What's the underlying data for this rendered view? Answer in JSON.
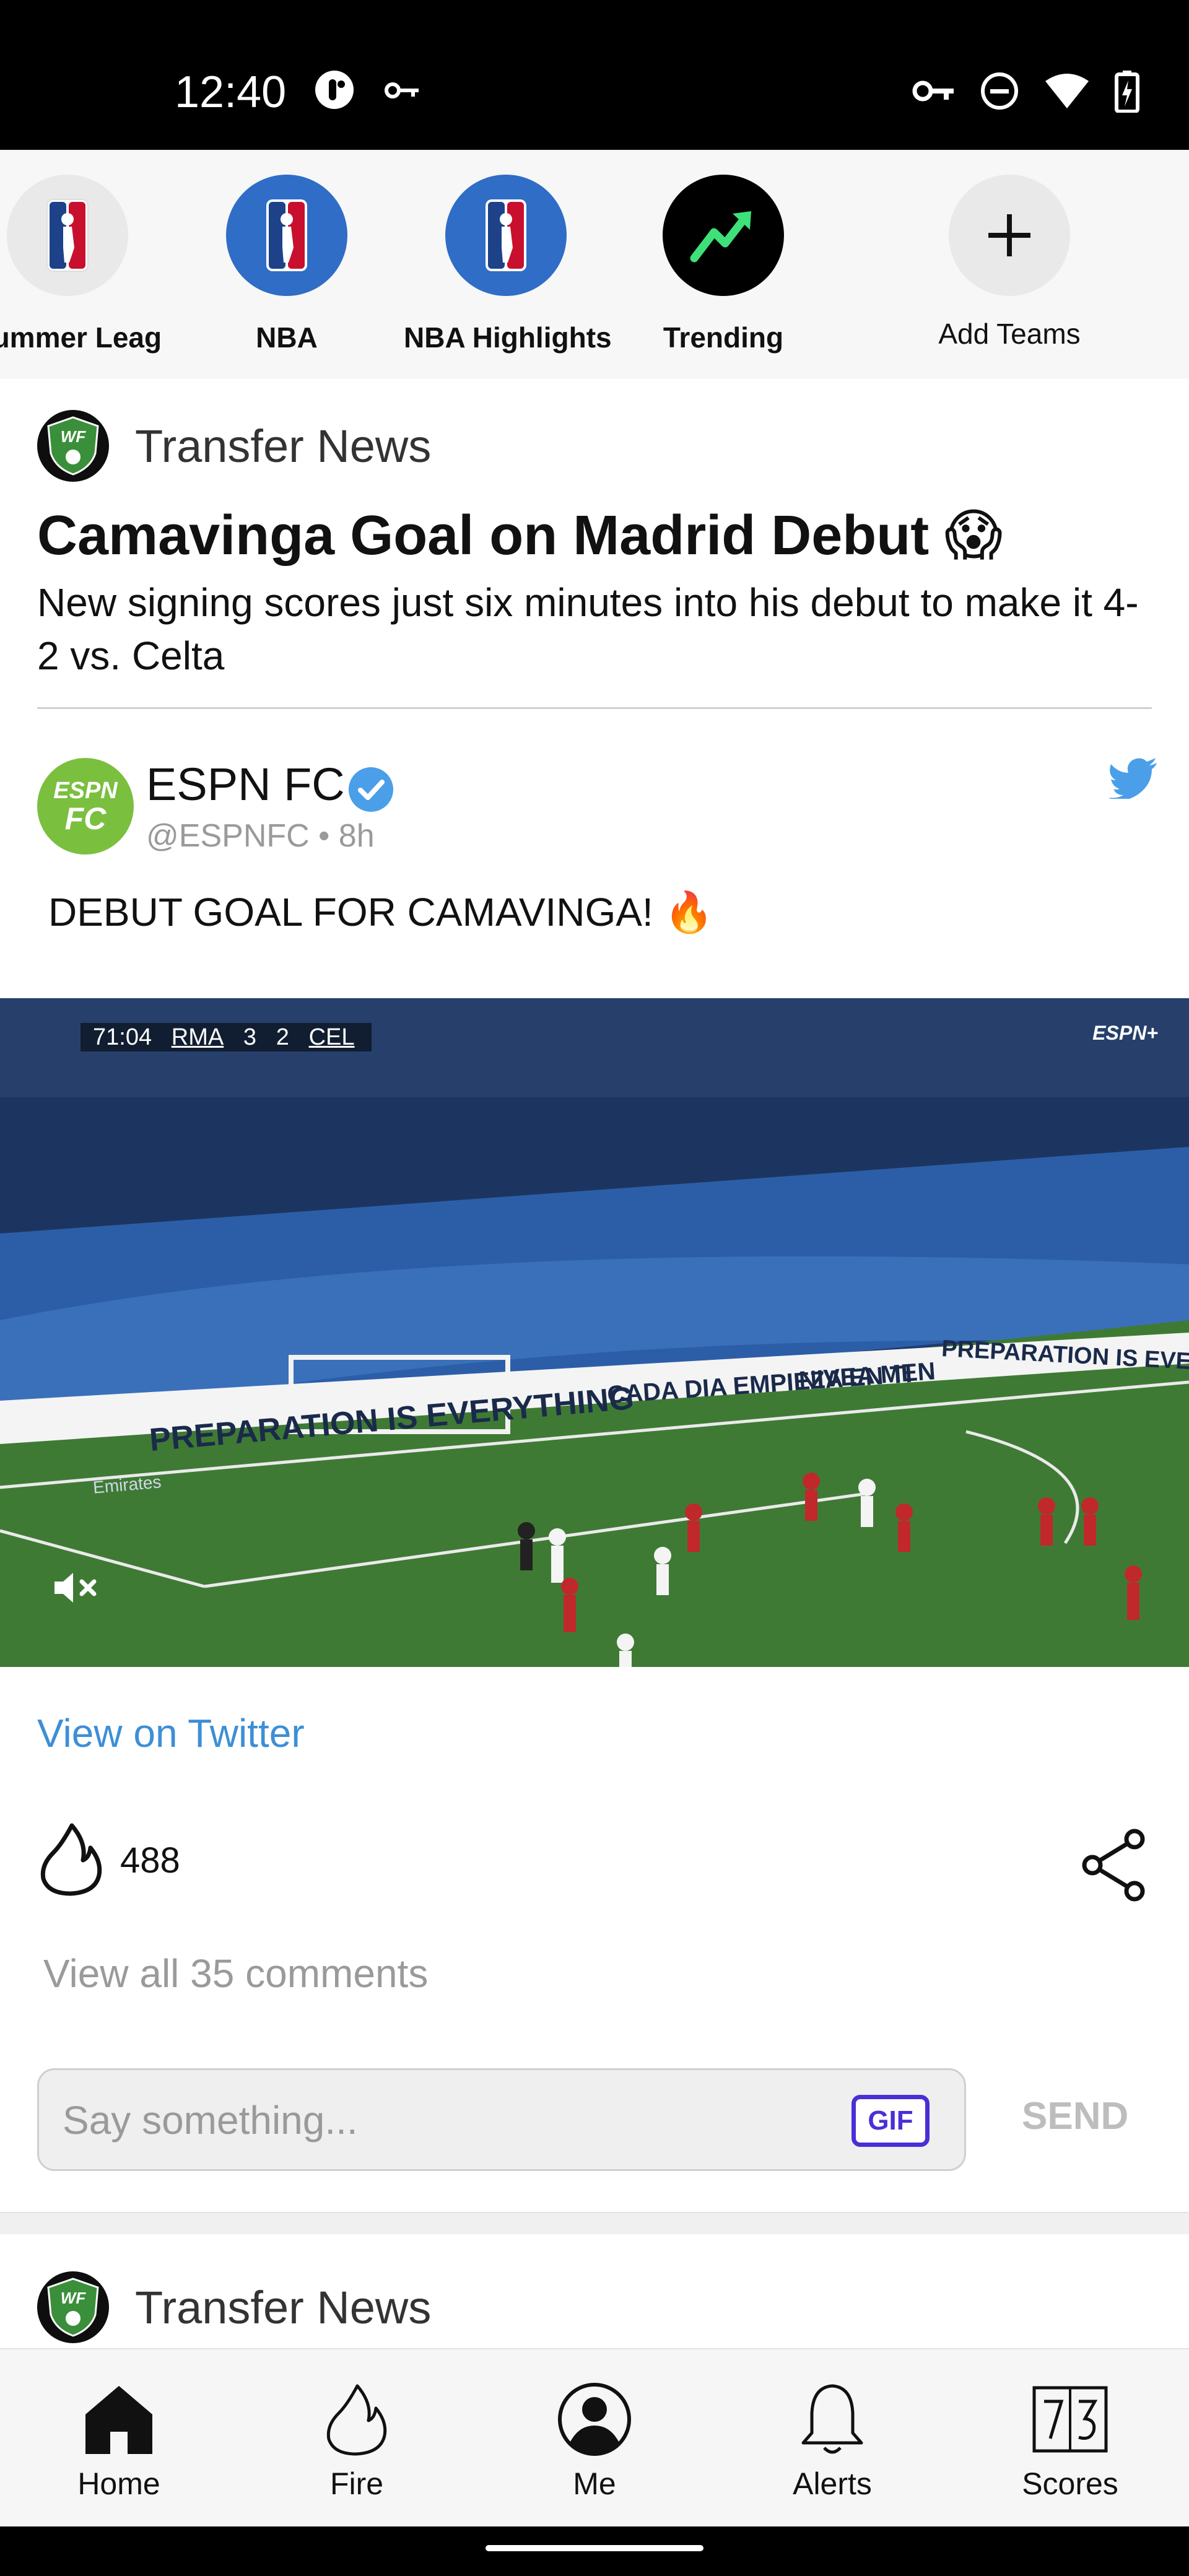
{
  "status_bar": {
    "time": "12:40"
  },
  "team_rail": {
    "teams": [
      {
        "label": "Summer Leag"
      },
      {
        "label": "NBA"
      },
      {
        "label": "NBA Highlights"
      },
      {
        "label": "Trending"
      },
      {
        "label": "Add Teams"
      }
    ]
  },
  "post": {
    "source": "Transfer News",
    "badge": "WF",
    "headline": "Camavinga Goal on Madrid Debut 😱",
    "subhead": "New signing scores just six minutes into his debut to make it 4-2 vs. Celta",
    "tweet": {
      "name": "ESPN FC",
      "handle": "@ESPNFC • 8h",
      "avatar_text_top": "ESPN",
      "avatar_text_bottom": "FC",
      "text": "DEBUT GOAL FOR CAMAVINGA! 🔥"
    },
    "video": {
      "clock": "71:04",
      "home": "RMA",
      "home_score": "3",
      "away_score": "2",
      "away": "CEL",
      "broadcaster": "ESPN+",
      "board_left": "PREPARATION IS EVERYTHING",
      "board_mid": "CADA DIA EMPIEZA EN TI",
      "board_sponsor": "NIVEA MEN",
      "board_right": "PREPARATION IS EVERYTHING",
      "board_low": "Emirates"
    },
    "view_on_twitter": "View on Twitter",
    "fire_count": "488",
    "view_comments": "View all 35 comments",
    "comment_placeholder": "Say something...",
    "gif_label": "GIF",
    "send_label": "SEND"
  },
  "next_post": {
    "source": "Transfer News",
    "badge": "WF"
  },
  "bottom_nav": {
    "items": [
      {
        "label": "Home"
      },
      {
        "label": "Fire"
      },
      {
        "label": "Me"
      },
      {
        "label": "Alerts"
      },
      {
        "label": "Scores"
      }
    ]
  },
  "colors": {
    "accent_link": "#3d8fd6",
    "nba_blue": "#2f6dc6",
    "gif_purple": "#4a2fd6",
    "trending_green": "#3ee07a"
  }
}
